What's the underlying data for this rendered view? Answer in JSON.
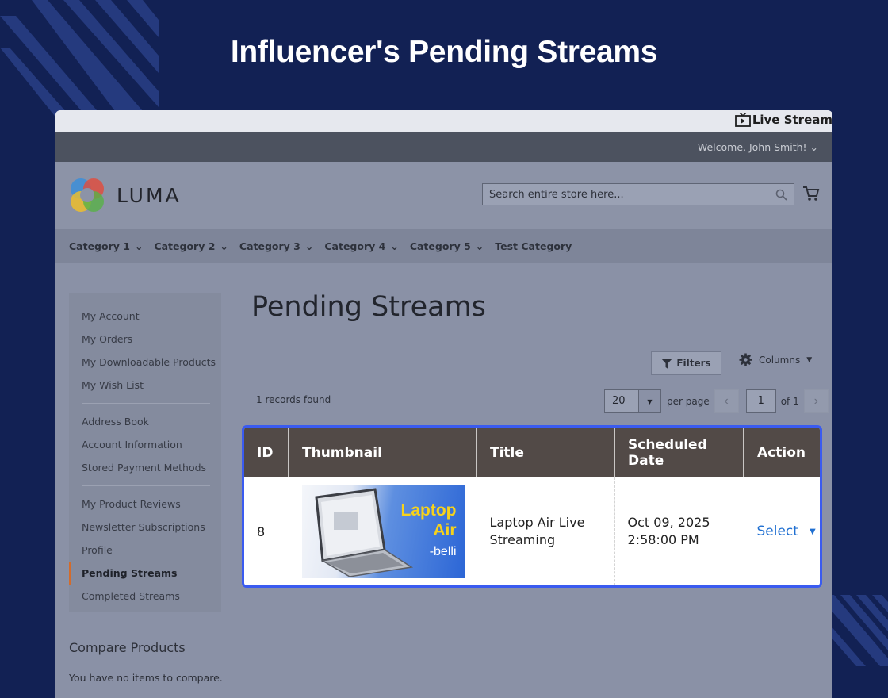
{
  "hero": {
    "title": "Influencer's Pending Streams"
  },
  "livestream": {
    "brand": "Live Stream"
  },
  "topbar": {
    "welcome": "Welcome, John Smith!"
  },
  "header": {
    "logo_text": "LUMA",
    "search_placeholder": "Search entire store here..."
  },
  "nav": {
    "items": [
      {
        "label": "Category 1",
        "has_dropdown": true
      },
      {
        "label": "Category 2",
        "has_dropdown": true
      },
      {
        "label": "Category 3",
        "has_dropdown": true
      },
      {
        "label": "Category 4",
        "has_dropdown": true
      },
      {
        "label": "Category 5",
        "has_dropdown": true
      },
      {
        "label": "Test Category",
        "has_dropdown": false
      }
    ]
  },
  "sidebar": {
    "groups": [
      [
        "My Account",
        "My Orders",
        "My Downloadable Products",
        "My Wish List"
      ],
      [
        "Address Book",
        "Account Information",
        "Stored Payment Methods"
      ],
      [
        "My Product Reviews",
        "Newsletter Subscriptions",
        "Profile",
        "Pending Streams",
        "Completed Streams"
      ]
    ],
    "active": "Pending Streams"
  },
  "compare": {
    "title": "Compare Products",
    "empty_text": "You have no items to compare."
  },
  "main": {
    "page_title": "Pending Streams",
    "filters_label": "Filters",
    "columns_label": "Columns",
    "records_found": "1 records found",
    "per_page_value": "20",
    "per_page_label": "per page",
    "page_value": "1",
    "page_of": "of 1"
  },
  "grid": {
    "columns": [
      "ID",
      "Thumbnail",
      "Title",
      "Scheduled Date",
      "Action"
    ],
    "rows": [
      {
        "id": "8",
        "thumbnail": {
          "title_line1": "Laptop",
          "title_line2": "Air",
          "subtitle": "-belli"
        },
        "title": "Laptop Air Live Streaming",
        "scheduled_date": "Oct 09, 2025 2:58:00 PM",
        "action": "Select"
      }
    ]
  },
  "colors": {
    "background": "#122154",
    "highlight_border": "#3a5bf0",
    "grid_header": "#524a47",
    "action_link": "#1f6fd1",
    "active_marker": "#d36b2b"
  }
}
